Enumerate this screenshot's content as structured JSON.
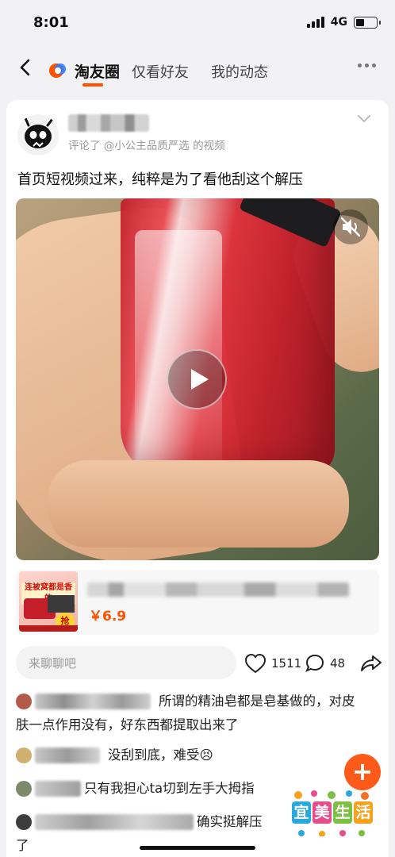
{
  "status": {
    "time": "8:01",
    "network": "4G"
  },
  "nav": {
    "tabs": [
      {
        "label": "淘友圈",
        "active": true
      },
      {
        "label": "仅看好友",
        "active": false
      },
      {
        "label": "我的动态",
        "active": false
      }
    ]
  },
  "post": {
    "meta": "评论了 @小公主品质严选 的视频",
    "text": "首页短视频过来，纯粹是为了看他刮这个解压",
    "product": {
      "price": "￥6.9",
      "image_texts": {
        "slogan": "连被窝都是香的",
        "grab": "抢"
      }
    },
    "actions": {
      "chat_placeholder": "来聊聊吧",
      "likes": "1511",
      "comments": "48"
    },
    "comments": [
      {
        "line1": "所谓的精油皂都是皂基做的，对皮",
        "line2": "肤一点作用没有，好东西都提取出来了"
      },
      {
        "line1": "没刮到底，难受😣"
      },
      {
        "line1": "只有我担心ta切到左手大拇指"
      },
      {
        "line1": "确实挺解压",
        "line2": "了"
      }
    ]
  },
  "watermark": {
    "chars": [
      "宜",
      "美",
      "生",
      "活"
    ]
  },
  "colors": {
    "accent": "#ff5000",
    "fab": "#ff5a1a"
  }
}
